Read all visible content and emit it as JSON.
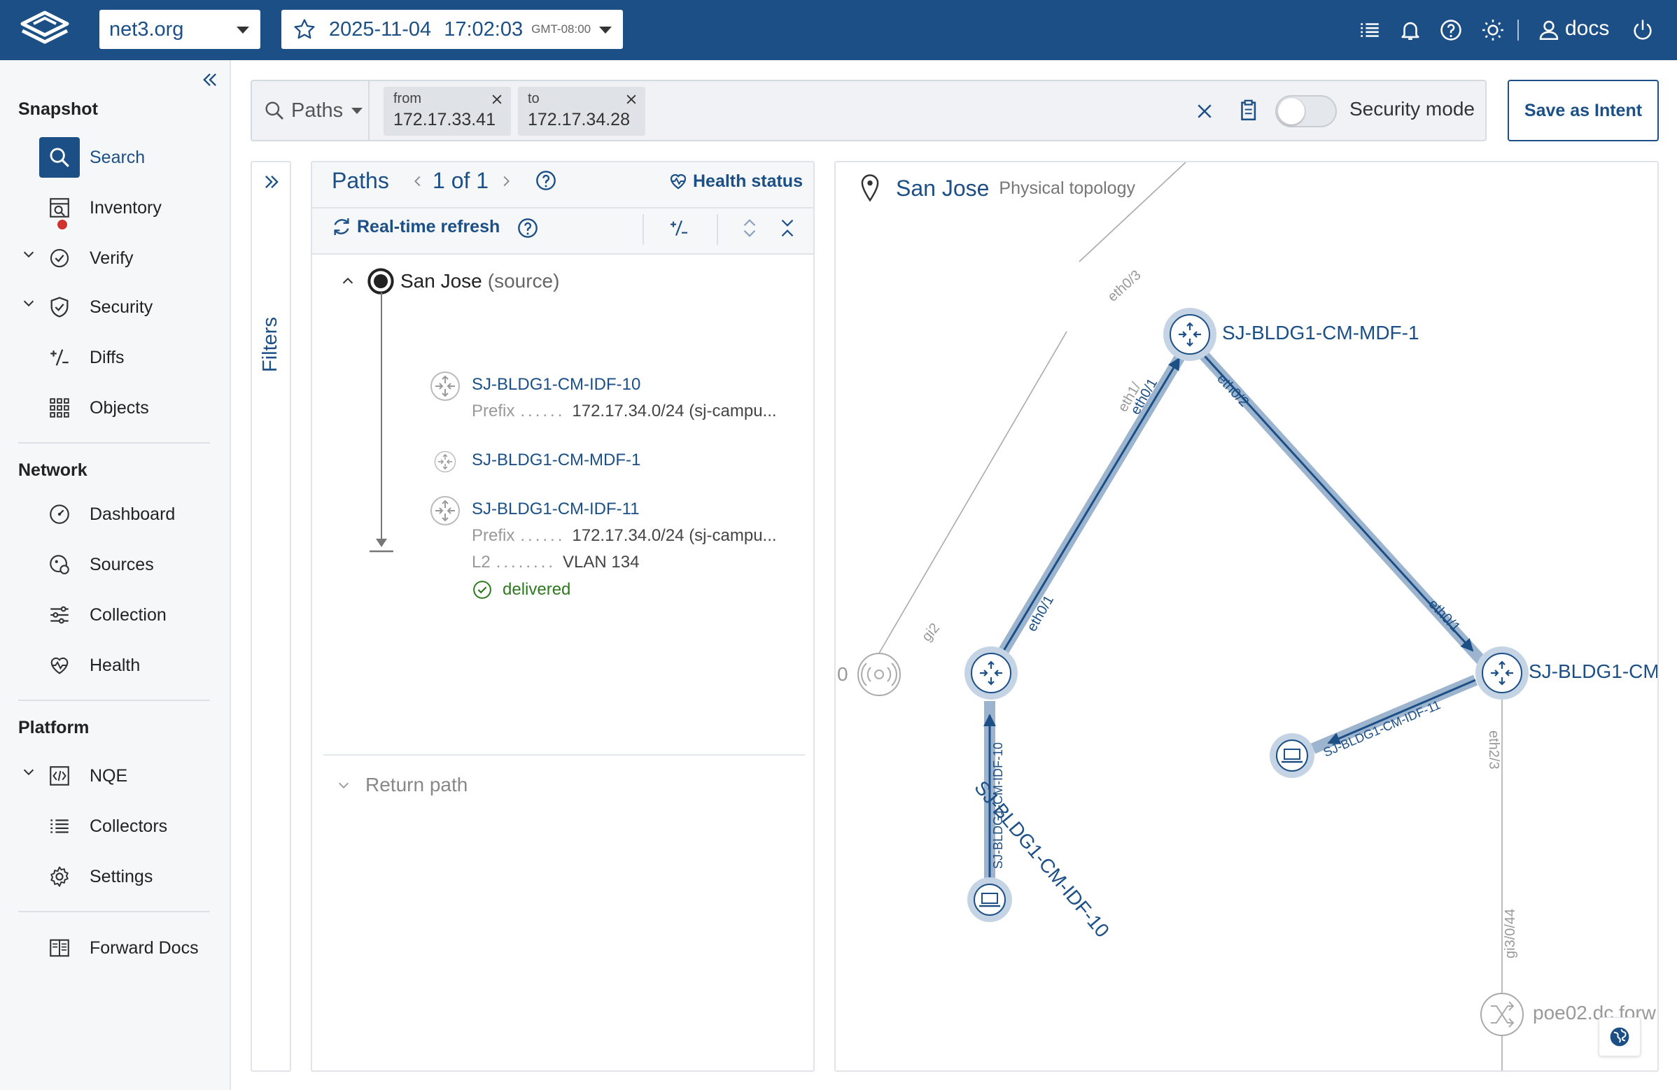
{
  "header": {
    "org": "net3.org",
    "snapshot_date": "2025-11-04",
    "snapshot_time": "17:02:03",
    "snapshot_tz": "GMT-08:00",
    "user": "docs",
    "bg_color": "#1b4f85"
  },
  "sidebar": {
    "sections": [
      {
        "title": "Snapshot",
        "items": [
          {
            "label": "Search",
            "icon": "search-icon",
            "active": true
          },
          {
            "label": "Inventory",
            "icon": "inventory-icon"
          },
          {
            "label": "Verify",
            "icon": "verify-icon",
            "expandable": true,
            "badge": true
          },
          {
            "label": "Security",
            "icon": "shield-icon",
            "expandable": true
          },
          {
            "label": "Diffs",
            "icon": "diff-icon"
          },
          {
            "label": "Objects",
            "icon": "grid-icon"
          }
        ]
      },
      {
        "title": "Network",
        "items": [
          {
            "label": "Dashboard",
            "icon": "dashboard-icon"
          },
          {
            "label": "Sources",
            "icon": "sources-icon"
          },
          {
            "label": "Collection",
            "icon": "collection-icon"
          },
          {
            "label": "Health",
            "icon": "health-icon"
          }
        ]
      },
      {
        "title": "Platform",
        "items": [
          {
            "label": "NQE",
            "icon": "nqe-icon",
            "expandable": true
          },
          {
            "label": "Collectors",
            "icon": "list-icon"
          },
          {
            "label": "Settings",
            "icon": "gear-icon"
          }
        ]
      }
    ],
    "footer_item": "Forward Docs"
  },
  "search": {
    "mode": "Paths",
    "chips": [
      {
        "key": "from",
        "value": "172.17.33.41"
      },
      {
        "key": "to",
        "value": "172.17.34.28"
      }
    ],
    "security_mode_label": "Security mode",
    "security_mode_on": false,
    "save_intent_label": "Save as Intent"
  },
  "filters": {
    "label": "Filters"
  },
  "paths_panel": {
    "title": "Paths",
    "count": "1 of 1",
    "health_label": "Health status",
    "refresh_label": "Real-time refresh",
    "diff_label": "+/-",
    "source_name": "San Jose",
    "source_suffix": "(source)",
    "hops": [
      {
        "name": "SJ-BLDG1-CM-IDF-10",
        "details": [
          {
            "k": "Prefix",
            "dots": "......",
            "v": "172.17.34.0/24 (sj-campu..."
          }
        ]
      },
      {
        "name": "SJ-BLDG1-CM-MDF-1",
        "details": []
      },
      {
        "name": "SJ-BLDG1-CM-IDF-11",
        "details": [
          {
            "k": "Prefix",
            "dots": "......",
            "v": "172.17.34.0/24 (sj-campu..."
          },
          {
            "k": "L2",
            "dots": "........",
            "v": "VLAN 134"
          }
        ]
      }
    ],
    "outcome": "delivered",
    "return_path_label": "Return path"
  },
  "topology": {
    "site": "San Jose",
    "subtitle": "Physical topology",
    "nodes": {
      "mdf": "SJ-BLDG1-CM-MDF-1",
      "idf10": "SJ-BLDG1-CM-IDF-10",
      "idf11_truncated": "SJ-BLDG1-CM",
      "ap_label": "0",
      "poe": "poe02.dc.forw"
    },
    "link_labels": {
      "top_eth": "eth0/3",
      "mdf_eth01": "eth0/1",
      "mdf_eth1x": "eth1/",
      "mdf_eth02": "eth0/2",
      "idf11_eth01": "eth0/1",
      "idf10_eth01": "eth0/1",
      "ap_gi2": "gi2",
      "idf11_eth23": "eth2/3",
      "idf10_host": "SJ-BLDG1-CM-IDF-10",
      "idf11_host": "SJ-BLDG1-CM-IDF-11",
      "poe_gi": "gi3/0/44"
    },
    "accent_color": "#1b4f85",
    "path_color": "#9db4cf"
  }
}
